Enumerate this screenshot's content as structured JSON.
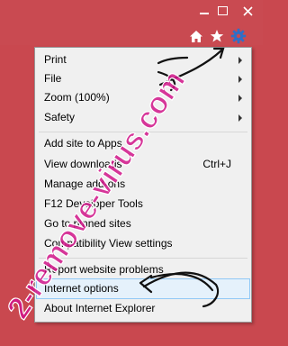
{
  "window": {
    "minimize_icon": "minimize-icon",
    "maximize_icon": "maximize-icon",
    "close_icon": "close-icon",
    "accent": "#c94a51"
  },
  "toolbar": {
    "home_icon": "home-icon",
    "favorites_icon": "star-icon",
    "tools_icon": "gear-icon"
  },
  "menu": {
    "items": [
      {
        "label": "Print",
        "submenu": true
      },
      {
        "label": "File",
        "submenu": true
      },
      {
        "label": "Zoom (100%)",
        "submenu": true
      },
      {
        "label": "Safety",
        "submenu": true
      },
      {
        "label": "Add site to Apps",
        "submenu": false
      },
      {
        "label": "View downloads",
        "shortcut": "Ctrl+J",
        "submenu": false
      },
      {
        "label": "Manage add-ons",
        "submenu": false
      },
      {
        "label": "F12 Developer Tools",
        "submenu": false
      },
      {
        "label": "Go to pinned sites",
        "submenu": false
      },
      {
        "label": "Compatibility View settings",
        "submenu": false
      },
      {
        "label": "Report website problems",
        "submenu": false
      },
      {
        "label": "Internet options",
        "submenu": false,
        "highlighted": true
      },
      {
        "label": "About Internet Explorer",
        "submenu": false
      }
    ]
  },
  "watermark": {
    "text": "2-remove-virus.com",
    "color": "#d1158a"
  }
}
